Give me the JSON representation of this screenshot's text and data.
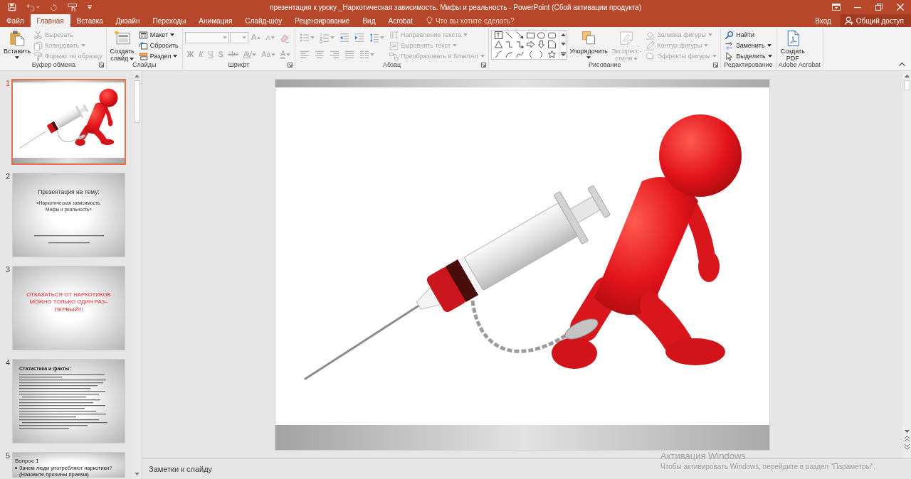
{
  "title_bar": {
    "title": "презентация к уроку _Наркотическая зависимость. Мифы и реальность - PowerPoint (Сбой активации продукта)"
  },
  "tabs": [
    {
      "label": "Файл",
      "selected": false
    },
    {
      "label": "Главная",
      "selected": true
    },
    {
      "label": "Вставка",
      "selected": false
    },
    {
      "label": "Дизайн",
      "selected": false
    },
    {
      "label": "Переходы",
      "selected": false
    },
    {
      "label": "Анимация",
      "selected": false
    },
    {
      "label": "Слайд-шоу",
      "selected": false
    },
    {
      "label": "Рецензирование",
      "selected": false
    },
    {
      "label": "Вид",
      "selected": false
    },
    {
      "label": "Acrobat",
      "selected": false
    }
  ],
  "tell_me": {
    "placeholder": "Что вы хотите сделать?"
  },
  "account": {
    "sign_in": "Вход",
    "share": "Общий доступ"
  },
  "ribbon": {
    "groups": [
      {
        "kind": "clipboard",
        "label": "Буфер обмена",
        "launcher": true,
        "large": [
          {
            "label": "Вставить",
            "disabled": false,
            "dropdown": true
          }
        ],
        "small": [
          {
            "label": "Вырезать",
            "disabled": true,
            "dropdown": false
          },
          {
            "label": "Копировать",
            "disabled": true,
            "dropdown": true
          },
          {
            "label": "Формат по образцу",
            "disabled": true,
            "dropdown": false
          }
        ]
      },
      {
        "kind": "slides",
        "label": "Слайды",
        "launcher": false,
        "large": [
          {
            "label": "Создать слайд",
            "disabled": false,
            "dropdown": true
          }
        ],
        "small": [
          {
            "label": "Макет",
            "disabled": false,
            "dropdown": true
          },
          {
            "label": "Сбросить",
            "disabled": false,
            "dropdown": false
          },
          {
            "label": "Раздел",
            "disabled": false,
            "dropdown": true
          }
        ]
      },
      {
        "kind": "font",
        "label": "Шрифт",
        "launcher": true,
        "fields": [
          {
            "disabled": true
          },
          {
            "disabled": true
          }
        ],
        "upper_buttons": [
          {
            "kind": "glyph",
            "text": "A",
            "disabled": true,
            "dropdown": false
          },
          {
            "kind": "glyph",
            "text": "A",
            "disabled": true,
            "dropdown": false
          },
          {
            "kind": "icon",
            "disabled": true,
            "dropdown": false
          }
        ],
        "lower_buttons": [
          {
            "kind": "glyph",
            "text": "Ж",
            "disabled": true,
            "dropdown": false
          },
          {
            "kind": "glyph",
            "text": "К",
            "disabled": true,
            "dropdown": false
          },
          {
            "kind": "glyph",
            "text": "Ч",
            "disabled": true,
            "dropdown": false
          },
          {
            "kind": "glyph",
            "text": "S",
            "disabled": true,
            "dropdown": false
          },
          {
            "kind": "glyph",
            "text": "abc",
            "disabled": true,
            "dropdown": false
          },
          {
            "kind": "glyph",
            "text": "AV",
            "disabled": true,
            "dropdown": true
          },
          {
            "kind": "glyph",
            "text": "Aa",
            "disabled": true,
            "dropdown": true
          },
          {
            "kind": "glyph",
            "text": "A",
            "disabled": true,
            "dropdown": true
          }
        ]
      },
      {
        "kind": "paragraph",
        "label": "Абзац",
        "launcher": true,
        "upper_buttons": [
          {
            "kind": "icon",
            "disabled": true,
            "dropdown": true
          },
          {
            "kind": "icon",
            "disabled": true,
            "dropdown": true
          },
          {
            "kind": "icon",
            "disabled": true,
            "dropdown": false
          },
          {
            "kind": "icon",
            "disabled": true,
            "dropdown": false
          },
          {
            "kind": "icon",
            "disabled": true,
            "dropdown": true
          }
        ],
        "lower_buttons": [
          {
            "kind": "icon",
            "disabled": true,
            "dropdown": false
          },
          {
            "kind": "icon",
            "disabled": true,
            "dropdown": false
          },
          {
            "kind": "icon",
            "disabled": true,
            "dropdown": false
          },
          {
            "kind": "icon",
            "disabled": true,
            "dropdown": false
          },
          {
            "kind": "icon",
            "disabled": true,
            "dropdown": true
          }
        ],
        "small": [
          {
            "label": "Направление текста",
            "disabled": true,
            "dropdown": true
          },
          {
            "label": "Выровнять текст",
            "disabled": true,
            "dropdown": true
          },
          {
            "label": "Преобразовать в SmartArt",
            "disabled": true,
            "dropdown": true
          }
        ]
      },
      {
        "kind": "drawing",
        "label": "Рисование",
        "launcher": true,
        "large": [
          {
            "label": "Упорядочить",
            "disabled": false,
            "dropdown": true
          },
          {
            "label": "Экспресс-стили",
            "disabled": true,
            "dropdown": true
          }
        ],
        "small": [
          {
            "label": "Заливка фигуры",
            "disabled": true,
            "dropdown": true
          },
          {
            "label": "Контур фигуры",
            "disabled": true,
            "dropdown": true
          },
          {
            "label": "Эффекты фигуры",
            "disabled": true,
            "dropdown": true
          }
        ]
      },
      {
        "kind": "editing",
        "label": "Редактирование",
        "launcher": false,
        "small": [
          {
            "label": "Найти",
            "disabled": false,
            "dropdown": false
          },
          {
            "label": "Заменить",
            "disabled": false,
            "dropdown": true
          },
          {
            "label": "Выделить",
            "disabled": false,
            "dropdown": true
          }
        ]
      },
      {
        "kind": "acrobat",
        "label": "Adobe Acrobat",
        "launcher": false,
        "large": [
          {
            "label": "Создать PDF",
            "disabled": false,
            "dropdown": false
          }
        ]
      }
    ]
  },
  "slides_pane": {
    "slides": [
      {
        "number": "1",
        "selected": true,
        "kind": "image"
      },
      {
        "number": "2",
        "selected": false,
        "kind": "title",
        "title": "Презентация на тему:",
        "subtitle": "«Наркотическая зависимость. Мифы и реальность»"
      },
      {
        "number": "3",
        "selected": false,
        "kind": "statement",
        "text": "ОТКАЗАТЬСЯ ОТ НАРКОТИКОВ МОЖНО ТОЛЬКО ОДИН РАЗ–ПЕРВЫЙ!!!"
      },
      {
        "number": "4",
        "selected": false,
        "kind": "text",
        "heading": "Статистика и факты:"
      },
      {
        "number": "5",
        "selected": false,
        "kind": "bullets",
        "title": "Вопрос 1",
        "bullets": [
          "Зачем люди употребляют наркотики? (Назовите причины приема)"
        ]
      }
    ]
  },
  "editor": {
    "slide": {
      "kind": "image"
    }
  },
  "notes": {
    "placeholder": "Заметки к слайду"
  },
  "activation_notice": {
    "title": "Активация Windows",
    "text": "Чтобы активировать Windows, перейдите в раздел \"Параметры\"."
  }
}
